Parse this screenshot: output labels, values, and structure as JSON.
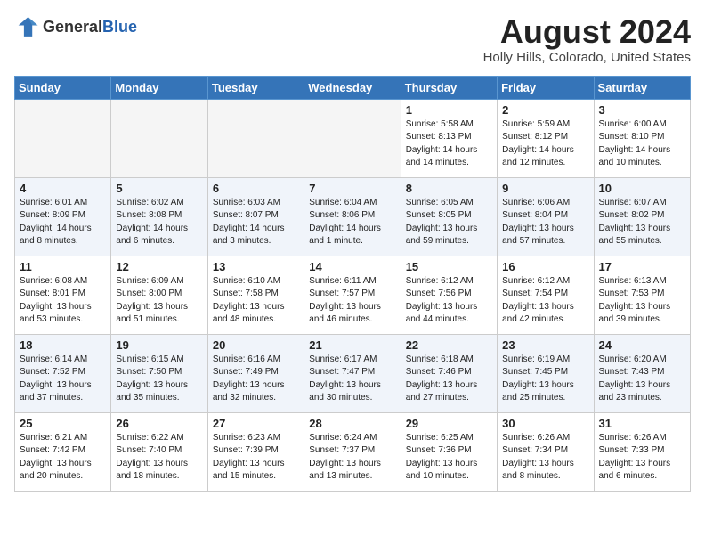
{
  "header": {
    "logo_general": "General",
    "logo_blue": "Blue",
    "month_year": "August 2024",
    "location": "Holly Hills, Colorado, United States"
  },
  "weekdays": [
    "Sunday",
    "Monday",
    "Tuesday",
    "Wednesday",
    "Thursday",
    "Friday",
    "Saturday"
  ],
  "weeks": [
    [
      {
        "day": "",
        "info": ""
      },
      {
        "day": "",
        "info": ""
      },
      {
        "day": "",
        "info": ""
      },
      {
        "day": "",
        "info": ""
      },
      {
        "day": "1",
        "info": "Sunrise: 5:58 AM\nSunset: 8:13 PM\nDaylight: 14 hours\nand 14 minutes."
      },
      {
        "day": "2",
        "info": "Sunrise: 5:59 AM\nSunset: 8:12 PM\nDaylight: 14 hours\nand 12 minutes."
      },
      {
        "day": "3",
        "info": "Sunrise: 6:00 AM\nSunset: 8:10 PM\nDaylight: 14 hours\nand 10 minutes."
      }
    ],
    [
      {
        "day": "4",
        "info": "Sunrise: 6:01 AM\nSunset: 8:09 PM\nDaylight: 14 hours\nand 8 minutes."
      },
      {
        "day": "5",
        "info": "Sunrise: 6:02 AM\nSunset: 8:08 PM\nDaylight: 14 hours\nand 6 minutes."
      },
      {
        "day": "6",
        "info": "Sunrise: 6:03 AM\nSunset: 8:07 PM\nDaylight: 14 hours\nand 3 minutes."
      },
      {
        "day": "7",
        "info": "Sunrise: 6:04 AM\nSunset: 8:06 PM\nDaylight: 14 hours\nand 1 minute."
      },
      {
        "day": "8",
        "info": "Sunrise: 6:05 AM\nSunset: 8:05 PM\nDaylight: 13 hours\nand 59 minutes."
      },
      {
        "day": "9",
        "info": "Sunrise: 6:06 AM\nSunset: 8:04 PM\nDaylight: 13 hours\nand 57 minutes."
      },
      {
        "day": "10",
        "info": "Sunrise: 6:07 AM\nSunset: 8:02 PM\nDaylight: 13 hours\nand 55 minutes."
      }
    ],
    [
      {
        "day": "11",
        "info": "Sunrise: 6:08 AM\nSunset: 8:01 PM\nDaylight: 13 hours\nand 53 minutes."
      },
      {
        "day": "12",
        "info": "Sunrise: 6:09 AM\nSunset: 8:00 PM\nDaylight: 13 hours\nand 51 minutes."
      },
      {
        "day": "13",
        "info": "Sunrise: 6:10 AM\nSunset: 7:58 PM\nDaylight: 13 hours\nand 48 minutes."
      },
      {
        "day": "14",
        "info": "Sunrise: 6:11 AM\nSunset: 7:57 PM\nDaylight: 13 hours\nand 46 minutes."
      },
      {
        "day": "15",
        "info": "Sunrise: 6:12 AM\nSunset: 7:56 PM\nDaylight: 13 hours\nand 44 minutes."
      },
      {
        "day": "16",
        "info": "Sunrise: 6:12 AM\nSunset: 7:54 PM\nDaylight: 13 hours\nand 42 minutes."
      },
      {
        "day": "17",
        "info": "Sunrise: 6:13 AM\nSunset: 7:53 PM\nDaylight: 13 hours\nand 39 minutes."
      }
    ],
    [
      {
        "day": "18",
        "info": "Sunrise: 6:14 AM\nSunset: 7:52 PM\nDaylight: 13 hours\nand 37 minutes."
      },
      {
        "day": "19",
        "info": "Sunrise: 6:15 AM\nSunset: 7:50 PM\nDaylight: 13 hours\nand 35 minutes."
      },
      {
        "day": "20",
        "info": "Sunrise: 6:16 AM\nSunset: 7:49 PM\nDaylight: 13 hours\nand 32 minutes."
      },
      {
        "day": "21",
        "info": "Sunrise: 6:17 AM\nSunset: 7:47 PM\nDaylight: 13 hours\nand 30 minutes."
      },
      {
        "day": "22",
        "info": "Sunrise: 6:18 AM\nSunset: 7:46 PM\nDaylight: 13 hours\nand 27 minutes."
      },
      {
        "day": "23",
        "info": "Sunrise: 6:19 AM\nSunset: 7:45 PM\nDaylight: 13 hours\nand 25 minutes."
      },
      {
        "day": "24",
        "info": "Sunrise: 6:20 AM\nSunset: 7:43 PM\nDaylight: 13 hours\nand 23 minutes."
      }
    ],
    [
      {
        "day": "25",
        "info": "Sunrise: 6:21 AM\nSunset: 7:42 PM\nDaylight: 13 hours\nand 20 minutes."
      },
      {
        "day": "26",
        "info": "Sunrise: 6:22 AM\nSunset: 7:40 PM\nDaylight: 13 hours\nand 18 minutes."
      },
      {
        "day": "27",
        "info": "Sunrise: 6:23 AM\nSunset: 7:39 PM\nDaylight: 13 hours\nand 15 minutes."
      },
      {
        "day": "28",
        "info": "Sunrise: 6:24 AM\nSunset: 7:37 PM\nDaylight: 13 hours\nand 13 minutes."
      },
      {
        "day": "29",
        "info": "Sunrise: 6:25 AM\nSunset: 7:36 PM\nDaylight: 13 hours\nand 10 minutes."
      },
      {
        "day": "30",
        "info": "Sunrise: 6:26 AM\nSunset: 7:34 PM\nDaylight: 13 hours\nand 8 minutes."
      },
      {
        "day": "31",
        "info": "Sunrise: 6:26 AM\nSunset: 7:33 PM\nDaylight: 13 hours\nand 6 minutes."
      }
    ]
  ]
}
